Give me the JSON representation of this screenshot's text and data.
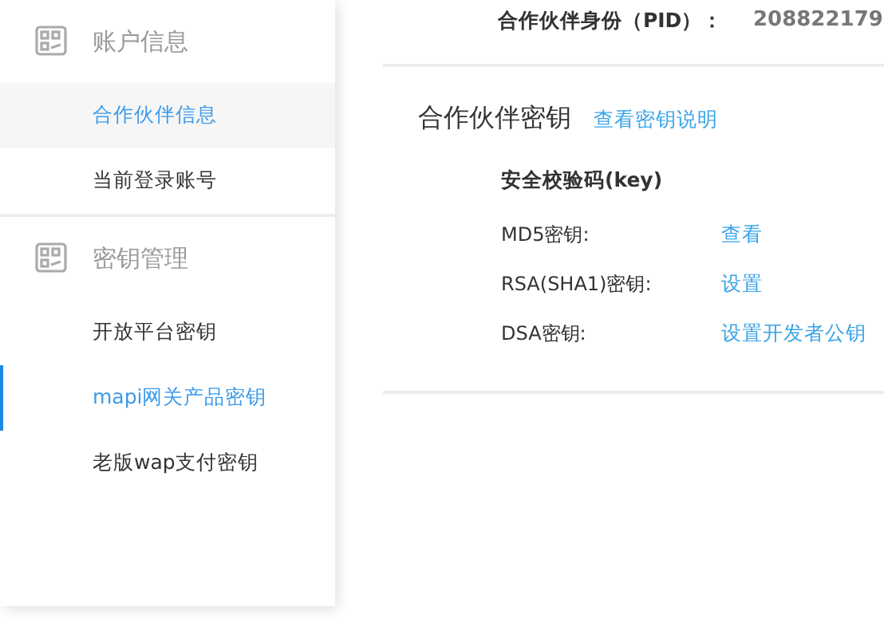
{
  "sidebar": {
    "groups": [
      {
        "title": "账户信息",
        "items": [
          {
            "label": "合作伙伴信息",
            "selected": false,
            "highlighted": true
          },
          {
            "label": "当前登录账号",
            "selected": false,
            "highlighted": false
          }
        ]
      },
      {
        "title": "密钥管理",
        "items": [
          {
            "label": "开放平台密钥",
            "selected": false,
            "highlighted": false
          },
          {
            "label": "mapi网关产品密钥",
            "selected": true,
            "highlighted": false
          },
          {
            "label": "老版wap支付密钥",
            "selected": false,
            "highlighted": false
          }
        ]
      }
    ]
  },
  "pid": {
    "label": "合作伙伴身份（PID）：",
    "value": "208822179"
  },
  "keys_section": {
    "title": "合作伙伴密钥",
    "help_link": "查看密钥说明",
    "subtitle": "安全校验码(key)",
    "rows": [
      {
        "label": "MD5密钥:",
        "action": "查看"
      },
      {
        "label": "RSA(SHA1)密钥:",
        "action": "设置"
      },
      {
        "label": "DSA密钥:",
        "action": "设置开发者公钥"
      }
    ]
  }
}
